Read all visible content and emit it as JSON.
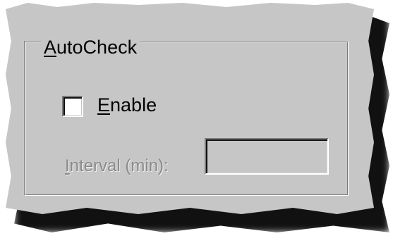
{
  "groupbox": {
    "title": "AutoCheck",
    "title_accel": "A",
    "title_rest": "utoCheck"
  },
  "enable_checkbox": {
    "label": "Enable",
    "label_accel": "E",
    "label_rest": "nable",
    "checked": false
  },
  "interval": {
    "label": "Interval (min):",
    "label_accel": "I",
    "label_rest": "nterval (min):",
    "value": "",
    "disabled": true
  },
  "colors": {
    "dialog_face": "#c6c6c6",
    "disabled_text": "#8a8a8a",
    "text": "#000000",
    "input_bg": "#ffffff"
  }
}
